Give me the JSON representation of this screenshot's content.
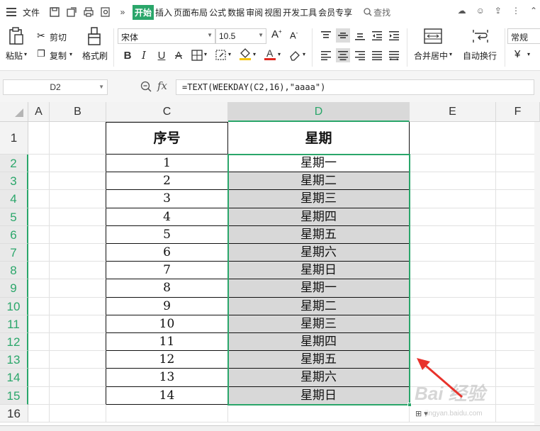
{
  "menubar": {
    "file": "文件",
    "tabs": [
      "开始",
      "插入",
      "页面布局",
      "公式",
      "数据",
      "审阅",
      "视图",
      "开发工具",
      "会员专享"
    ],
    "search": "查找"
  },
  "toolbar": {
    "paste": "粘贴",
    "cut": "剪切",
    "copy": "复制",
    "format_painter": "格式刷",
    "font_name": "宋体",
    "font_size": "10.5",
    "merge_center": "合并居中",
    "wrap_text": "自动换行",
    "number_format": "常规",
    "currency": "¥"
  },
  "formula_bar": {
    "name_box": "D2",
    "fx": "fx",
    "formula": "=TEXT(WEEKDAY(C2,16),\"aaaa\")"
  },
  "grid": {
    "columns": [
      "A",
      "B",
      "C",
      "D",
      "E",
      "F"
    ],
    "active_column": "D",
    "rows": [
      "1",
      "2",
      "3",
      "4",
      "5",
      "6",
      "7",
      "8",
      "9",
      "10",
      "11",
      "12",
      "13",
      "14",
      "15",
      "16"
    ],
    "header_c": "序号",
    "header_d": "星期",
    "c_values": [
      "1",
      "2",
      "3",
      "4",
      "5",
      "6",
      "7",
      "8",
      "9",
      "10",
      "11",
      "12",
      "13",
      "14"
    ],
    "d_values": [
      "星期一",
      "星期二",
      "星期三",
      "星期四",
      "星期五",
      "星期六",
      "星期日",
      "星期一",
      "星期二",
      "星期三",
      "星期四",
      "星期五",
      "星期六",
      "星期日"
    ]
  },
  "colors": {
    "accent": "#2aa66a",
    "selection_fill": "#d8d8d8",
    "arrow": "#e8322b"
  },
  "watermark": {
    "main": "Bai 经验",
    "sub": "jingyan.baidu.com"
  }
}
